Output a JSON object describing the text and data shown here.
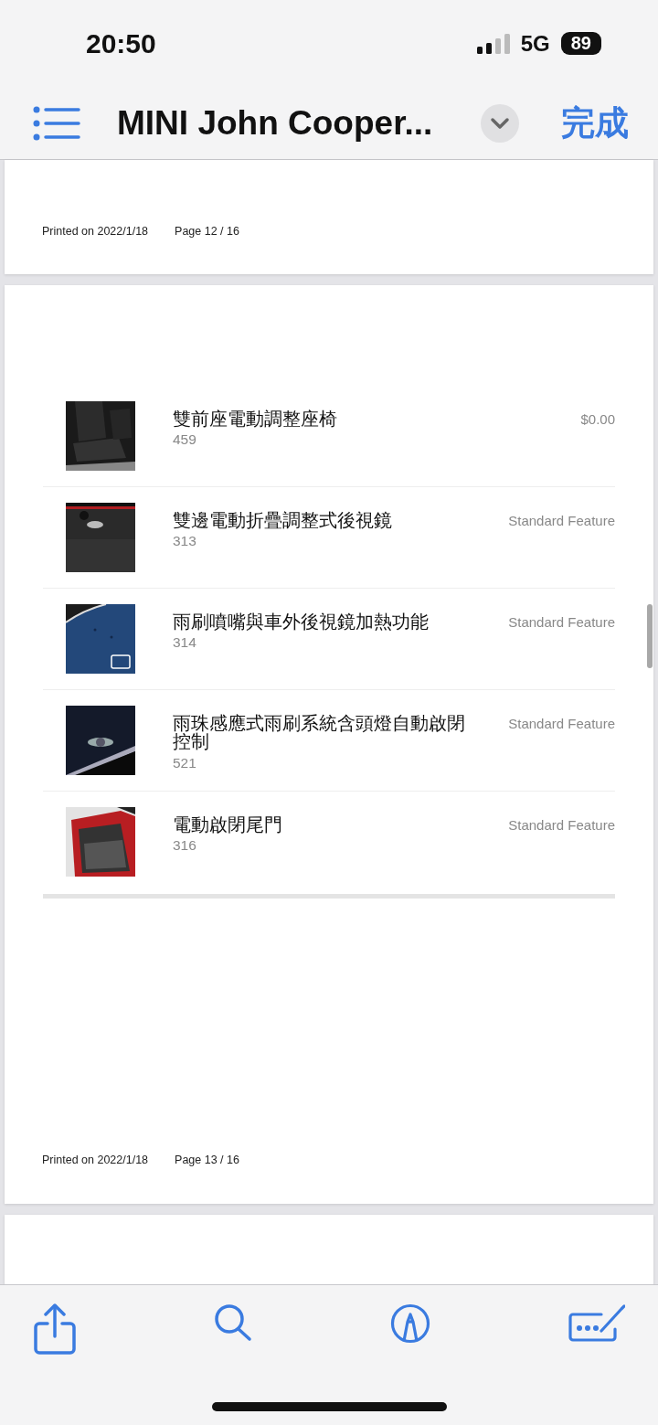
{
  "status_bar": {
    "time": "20:50",
    "network": "5G",
    "battery": "89"
  },
  "nav_bar": {
    "title": "MINI John Cooper...",
    "done": "完成"
  },
  "pages": [
    {
      "kind": "footer_only",
      "footer": {
        "printed": "Printed on 2022/1/18",
        "page": "Page 12 / 16"
      }
    },
    {
      "kind": "options",
      "items": [
        {
          "title": "雙前座電動調整座椅",
          "code": "459",
          "price": "$0.00"
        },
        {
          "title": "雙邊電動折疊調整式後視鏡",
          "code": "313",
          "price": "Standard Feature"
        },
        {
          "title": "雨刷噴嘴與車外後視鏡加熱功能",
          "code": "314",
          "price": "Standard Feature"
        },
        {
          "title": "雨珠感應式雨刷系統含頭燈自動啟閉控制",
          "code": "521",
          "price": "Standard Feature"
        },
        {
          "title": "電動啟閉尾門",
          "code": "316",
          "price": "Standard Feature"
        }
      ],
      "footer": {
        "printed": "Printed on 2022/1/18",
        "page": "Page 13 / 16"
      }
    },
    {
      "kind": "blank"
    }
  ]
}
